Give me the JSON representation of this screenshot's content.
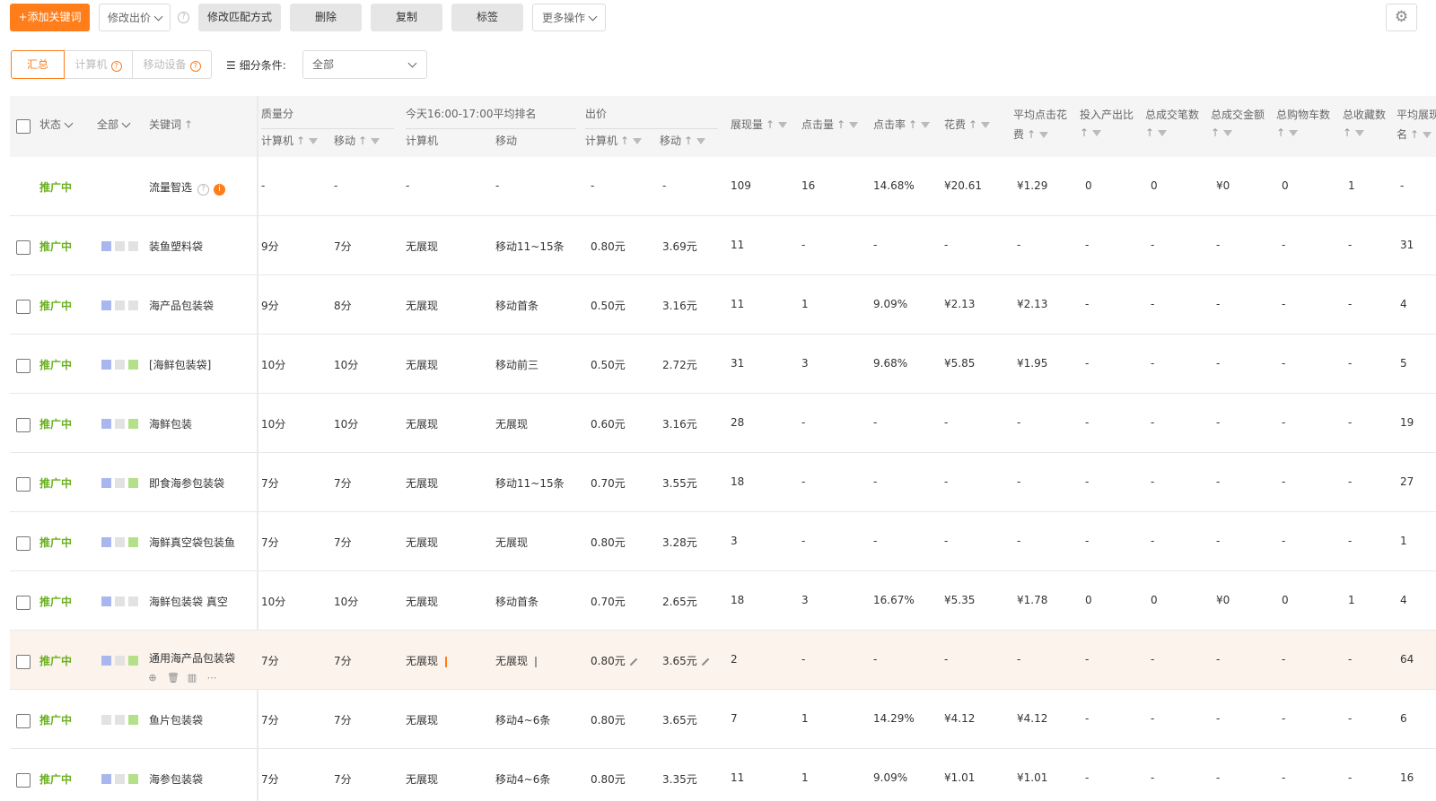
{
  "toolbar": {
    "add_keyword": "+添加关键词",
    "modify_bid": "修改出价",
    "modify_match": "修改匹配方式",
    "delete": "删除",
    "copy": "复制",
    "tag": "标签",
    "more_ops": "更多操作"
  },
  "filters": {
    "tabs": [
      "汇总",
      "计算机",
      "移动设备"
    ],
    "segment_label": "细分条件:",
    "segment_value": "全部"
  },
  "header": {
    "status": "状态",
    "all": "全部",
    "keyword": "关键词",
    "quality": "质量分",
    "rank": "今天16:00-17:00平均排名",
    "bid": "出价",
    "pc": "计算机",
    "mobile": "移动",
    "impressions": "展现量",
    "clicks": "点击量",
    "ctr": "点击率",
    "cost": "花费",
    "avg_cpc_1": "平均点击花",
    "avg_cpc_2": "费",
    "roi": "投入产出比",
    "total_orders": "总成交笔数",
    "total_amount": "总成交金额",
    "cart": "总购物车数",
    "fav": "总收藏数",
    "avg_rank_1": "平均展现",
    "avg_rank_2": "名"
  },
  "colors": {
    "accent": "#ff7d1a",
    "status": "#6ab01f",
    "highlight_row": "#fcf3ec"
  },
  "rows": [
    {
      "status": "推广中",
      "name": "流量智选",
      "squares": [],
      "special": true,
      "qpc": "-",
      "qmob": "-",
      "rpc": "-",
      "rmob": "-",
      "bpc": "-",
      "bmob": "-",
      "imp": "109",
      "clk": "16",
      "ctr": "14.68%",
      "cost": "¥20.61",
      "cpc": "¥1.29",
      "roi": "0",
      "orders": "0",
      "amount": "¥0",
      "cart": "0",
      "fav": "1",
      "avgrank": "-"
    },
    {
      "status": "推广中",
      "name": "装鱼塑料袋",
      "squares": [
        "#a8b8ee",
        "#e2e2e2",
        "#e2e2e2"
      ],
      "qpc": "9分",
      "qmob": "7分",
      "rpc": "无展现",
      "rmob": "移动11~15条",
      "bpc": "0.80元",
      "bmob": "3.69元",
      "imp": "11",
      "clk": "-",
      "ctr": "-",
      "cost": "-",
      "cpc": "-",
      "roi": "-",
      "orders": "-",
      "amount": "-",
      "cart": "-",
      "fav": "-",
      "avgrank": "31"
    },
    {
      "status": "推广中",
      "name": "海产品包装袋",
      "squares": [
        "#a8b8ee",
        "#e2e2e2",
        "#e2e2e2"
      ],
      "qpc": "9分",
      "qmob": "8分",
      "rpc": "无展现",
      "rmob": "移动首条",
      "bpc": "0.50元",
      "bmob": "3.16元",
      "imp": "11",
      "clk": "1",
      "ctr": "9.09%",
      "cost": "¥2.13",
      "cpc": "¥2.13",
      "roi": "-",
      "orders": "-",
      "amount": "-",
      "cart": "-",
      "fav": "-",
      "avgrank": "4"
    },
    {
      "status": "推广中",
      "name": "[海鲜包装袋]",
      "squares": [
        "#a8b8ee",
        "#e2e2e2",
        "#b5e08a"
      ],
      "qpc": "10分",
      "qmob": "10分",
      "rpc": "无展现",
      "rmob": "移动前三",
      "bpc": "0.50元",
      "bmob": "2.72元",
      "imp": "31",
      "clk": "3",
      "ctr": "9.68%",
      "cost": "¥5.85",
      "cpc": "¥1.95",
      "roi": "-",
      "orders": "-",
      "amount": "-",
      "cart": "-",
      "fav": "-",
      "avgrank": "5"
    },
    {
      "status": "推广中",
      "name": "海鲜包装",
      "squares": [
        "#a8b8ee",
        "#e2e2e2",
        "#b5e08a"
      ],
      "qpc": "10分",
      "qmob": "10分",
      "rpc": "无展现",
      "rmob": "无展现",
      "bpc": "0.60元",
      "bmob": "3.16元",
      "imp": "28",
      "clk": "-",
      "ctr": "-",
      "cost": "-",
      "cpc": "-",
      "roi": "-",
      "orders": "-",
      "amount": "-",
      "cart": "-",
      "fav": "-",
      "avgrank": "19"
    },
    {
      "status": "推广中",
      "name": "即食海参包装袋",
      "squares": [
        "#a8b8ee",
        "#e2e2e2",
        "#b5e08a"
      ],
      "qpc": "7分",
      "qmob": "7分",
      "rpc": "无展现",
      "rmob": "移动11~15条",
      "bpc": "0.70元",
      "bmob": "3.55元",
      "imp": "18",
      "clk": "-",
      "ctr": "-",
      "cost": "-",
      "cpc": "-",
      "roi": "-",
      "orders": "-",
      "amount": "-",
      "cart": "-",
      "fav": "-",
      "avgrank": "27"
    },
    {
      "status": "推广中",
      "name": "海鲜真空袋包装鱼",
      "squares": [
        "#a8b8ee",
        "#e2e2e2",
        "#b5e08a"
      ],
      "qpc": "7分",
      "qmob": "7分",
      "rpc": "无展现",
      "rmob": "无展现",
      "bpc": "0.80元",
      "bmob": "3.28元",
      "imp": "3",
      "clk": "-",
      "ctr": "-",
      "cost": "-",
      "cpc": "-",
      "roi": "-",
      "orders": "-",
      "amount": "-",
      "cart": "-",
      "fav": "-",
      "avgrank": "1"
    },
    {
      "status": "推广中",
      "name": "海鲜包装袋 真空",
      "squares": [
        "#a8b8ee",
        "#e2e2e2",
        "#e2e2e2"
      ],
      "qpc": "10分",
      "qmob": "10分",
      "rpc": "无展现",
      "rmob": "移动首条",
      "bpc": "0.70元",
      "bmob": "2.65元",
      "imp": "18",
      "clk": "3",
      "ctr": "16.67%",
      "cost": "¥5.35",
      "cpc": "¥1.78",
      "roi": "0",
      "orders": "0",
      "amount": "¥0",
      "cart": "0",
      "fav": "1",
      "avgrank": "4"
    },
    {
      "status": "推广中",
      "name": "通用海产品包装袋",
      "squares": [
        "#a8b8ee",
        "#e2e2e2",
        "#b5e08a"
      ],
      "hover": true,
      "qpc": "7分",
      "qmob": "7分",
      "rpc": "无展现",
      "rmob": "无展现",
      "bpc": "0.80元",
      "bmob": "3.65元",
      "imp": "2",
      "clk": "-",
      "ctr": "-",
      "cost": "-",
      "cpc": "-",
      "roi": "-",
      "orders": "-",
      "amount": "-",
      "cart": "-",
      "fav": "-",
      "avgrank": "64"
    },
    {
      "status": "推广中",
      "name": "鱼片包装袋",
      "squares": [
        "#e2e2e2",
        "#e2e2e2",
        "#b5e08a"
      ],
      "qpc": "7分",
      "qmob": "7分",
      "rpc": "无展现",
      "rmob": "移动4~6条",
      "bpc": "0.80元",
      "bmob": "3.65元",
      "imp": "7",
      "clk": "1",
      "ctr": "14.29%",
      "cost": "¥4.12",
      "cpc": "¥4.12",
      "roi": "-",
      "orders": "-",
      "amount": "-",
      "cart": "-",
      "fav": "-",
      "avgrank": "6"
    },
    {
      "status": "推广中",
      "name": "海参包装袋",
      "squares": [
        "#a8b8ee",
        "#e2e2e2",
        "#b5e08a"
      ],
      "qpc": "7分",
      "qmob": "7分",
      "rpc": "无展现",
      "rmob": "移动4~6条",
      "bpc": "0.80元",
      "bmob": "3.35元",
      "imp": "11",
      "clk": "1",
      "ctr": "9.09%",
      "cost": "¥1.01",
      "cpc": "¥1.01",
      "roi": "-",
      "orders": "-",
      "amount": "-",
      "cart": "-",
      "fav": "-",
      "avgrank": "16"
    }
  ]
}
